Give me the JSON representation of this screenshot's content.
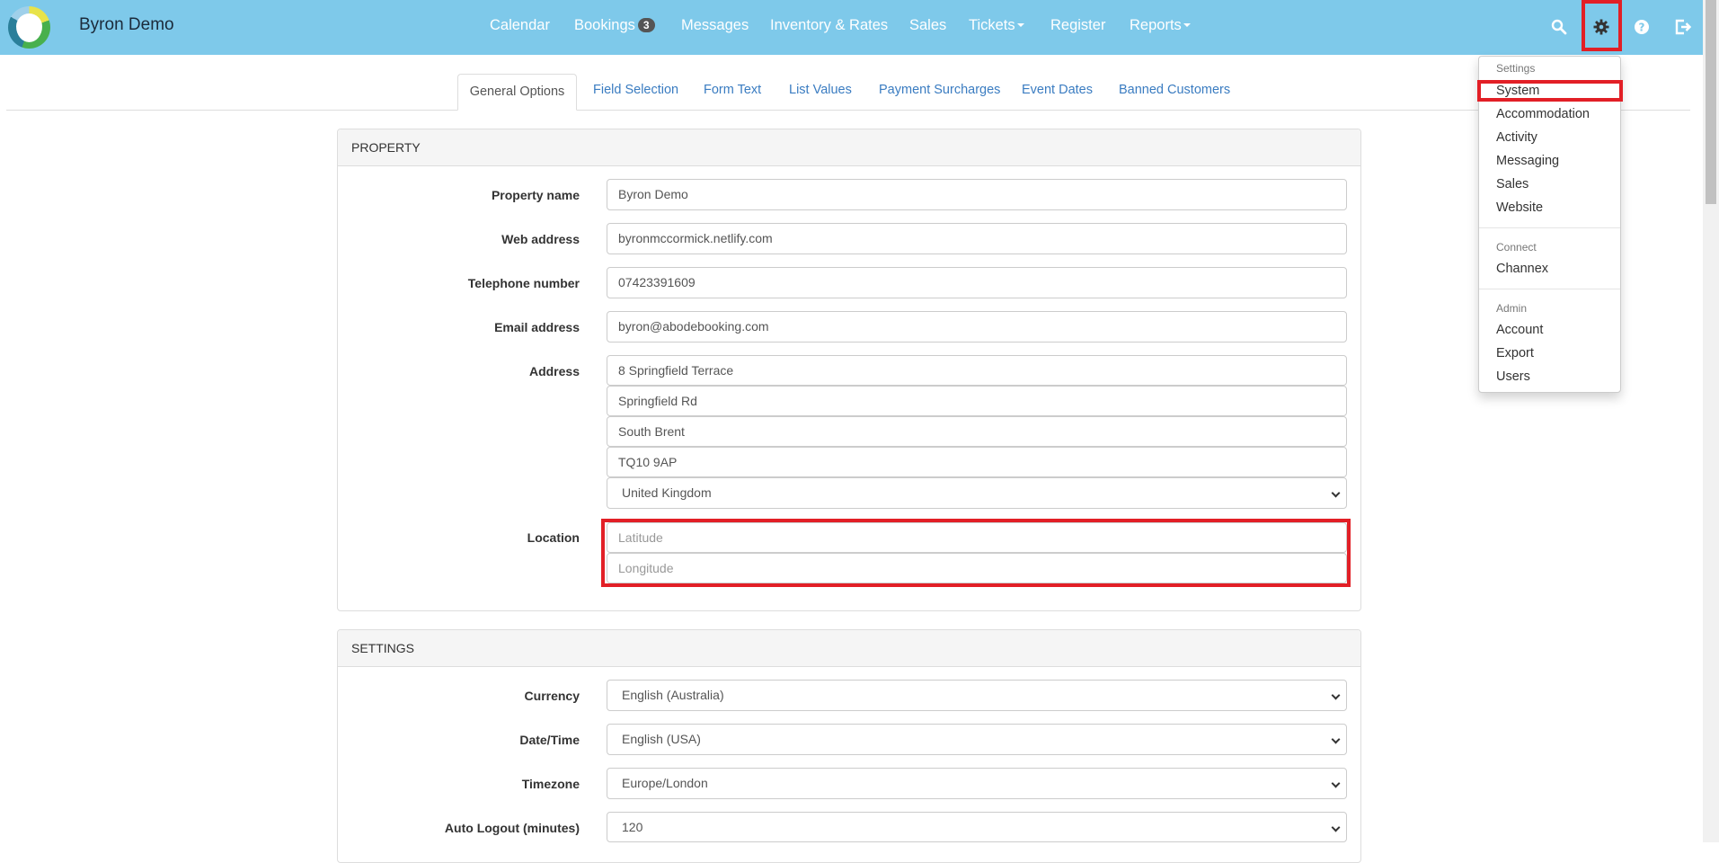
{
  "brand": {
    "name": "Byron Demo"
  },
  "nav": {
    "calendar": "Calendar",
    "bookings": "Bookings",
    "bookings_badge": "3",
    "messages": "Messages",
    "inventory": "Inventory & Rates",
    "sales": "Sales",
    "tickets": "Tickets",
    "register": "Register",
    "reports": "Reports",
    "icons": [
      "search-icon",
      "gear-icon",
      "help-icon",
      "logout-icon"
    ]
  },
  "tabs": {
    "general": "General Options",
    "field_selection": "Field Selection",
    "form_text": "Form Text",
    "list_values": "List Values",
    "payment_surcharges": "Payment Surcharges",
    "event_dates": "Event Dates",
    "banned_customers": "Banned Customers"
  },
  "property": {
    "heading": "PROPERTY",
    "property_name_label": "Property name",
    "property_name": "Byron Demo",
    "web_address_label": "Web address",
    "web_address": "byronmccormick.netlify.com",
    "telephone_label": "Telephone number",
    "telephone": "07423391609",
    "email_label": "Email address",
    "email": "byron@abodebooking.com",
    "address_label": "Address",
    "address_line1": "8 Springfield Terrace",
    "address_line2": "Springfield Rd",
    "address_line3": "South Brent",
    "postcode": "TQ10 9AP",
    "country": "United Kingdom",
    "location_label": "Location",
    "latitude_placeholder": "Latitude",
    "longitude_placeholder": "Longitude"
  },
  "settings": {
    "heading": "SETTINGS",
    "currency_label": "Currency",
    "currency": "English (Australia)",
    "datetime_label": "Date/Time",
    "datetime": "English (USA)",
    "timezone_label": "Timezone",
    "timezone": "Europe/London",
    "autologout_label": "Auto Logout (minutes)",
    "autologout": "120"
  },
  "dropdown": {
    "settings_header": "Settings",
    "system": "System",
    "accommodation": "Accommodation",
    "activity": "Activity",
    "messaging": "Messaging",
    "sales": "Sales",
    "website": "Website",
    "connect_header": "Connect",
    "channex": "Channex",
    "admin_header": "Admin",
    "account": "Account",
    "export": "Export",
    "users": "Users"
  },
  "colors": {
    "navbar": "#7ec9ea",
    "highlight": "#e21f26",
    "link": "#3a7cc1"
  }
}
